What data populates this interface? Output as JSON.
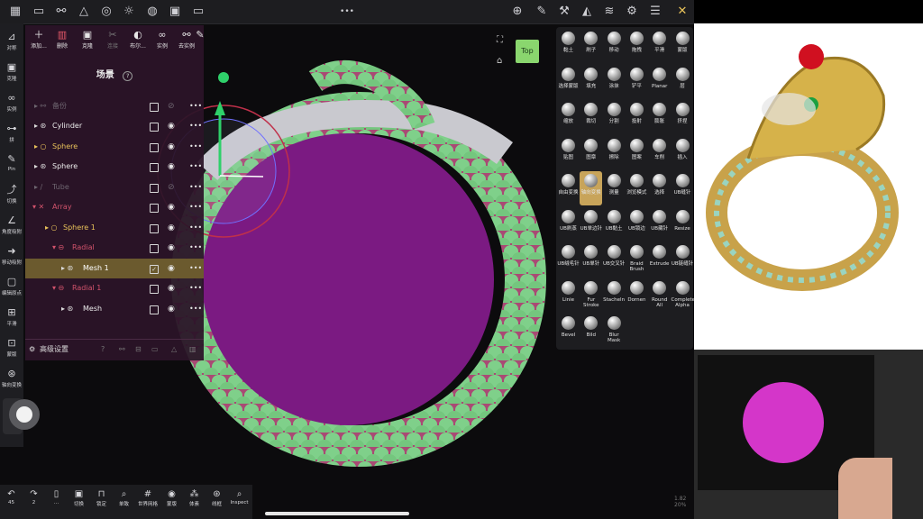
{
  "toolbar": {
    "icons": [
      "folder-icon",
      "share-graph-icon",
      "mesh-icon",
      "globe-icon",
      "sun-icon",
      "material-ball-icon",
      "image-icon",
      "video-icon"
    ],
    "dots": "•••"
  },
  "left_tools": [
    {
      "label": "对称",
      "icon": "symmetry-icon"
    },
    {
      "label": "克隆",
      "icon": "clone-icon"
    },
    {
      "label": "实例",
      "icon": "link-icon"
    },
    {
      "label": "拼",
      "icon": "join-icon"
    },
    {
      "label": "Pin",
      "icon": "pin-icon"
    },
    {
      "label": "切换",
      "icon": "switch-icon"
    },
    {
      "label": "角度吸附",
      "icon": "angle-snap-icon"
    },
    {
      "label": "移动吸附",
      "icon": "move-snap-icon"
    },
    {
      "label": "编辑原点",
      "icon": "lock-icon"
    },
    {
      "label": "平滑",
      "icon": "smooth-icon"
    },
    {
      "label": "蒙版",
      "icon": "mask-icon"
    },
    {
      "label": "轴向变换",
      "icon": "gizmo-icon"
    }
  ],
  "scene_panel": {
    "tools": [
      {
        "label": "添加...",
        "icon": "plus-icon"
      },
      {
        "label": "删除",
        "icon": "trash-icon"
      },
      {
        "label": "克隆",
        "icon": "clone-icon"
      },
      {
        "label": "连接",
        "icon": "connect-icon"
      },
      {
        "label": "布尔...",
        "icon": "boolean-icon"
      },
      {
        "label": "实例",
        "icon": "link-icon"
      },
      {
        "label": "去实例",
        "icon": "unlink-icon"
      },
      {
        "label": "",
        "icon": "pin-icon"
      }
    ],
    "title": "场景",
    "help": "?",
    "rows": [
      {
        "name": "备份",
        "color": "#6e6670"
      },
      {
        "name": "Cylinder",
        "color": "#ececec"
      },
      {
        "name": "Sphere",
        "color": "#e8c25a"
      },
      {
        "name": "Sphere",
        "color": "#ececec"
      },
      {
        "name": "Tube",
        "color": "#6e6670"
      },
      {
        "name": "Array",
        "color": "#d2536c"
      },
      {
        "name": "Sphere 1",
        "color": "#e8c25a"
      },
      {
        "name": "Radial",
        "color": "#d2536c"
      },
      {
        "name": "Mesh 1",
        "color": "#ffffff"
      },
      {
        "name": "Radial 1",
        "color": "#d2536c"
      },
      {
        "name": "Mesh",
        "color": "#ececec"
      }
    ],
    "footer_label": "高级设置"
  },
  "view_widget": {
    "label": "Top"
  },
  "brushes": [
    "黏土",
    "刷子",
    "移动",
    "拖拽",
    "平滑",
    "蒙版",
    "选择蒙版",
    "填充",
    "涂抹",
    "铲平",
    "Planar",
    "层",
    "缩放",
    "裁切",
    "分割",
    "投射",
    "膨胀",
    "挤捏",
    "贴图",
    "图章",
    "擦除",
    "图案",
    "车削",
    "插入",
    "自由变换",
    "轴向变换",
    "测量",
    "浏览模式",
    "选择",
    "UB缝针",
    "UB刷蒸",
    "UB单边针",
    "UB黏土",
    "UB锁边",
    "UB藏针",
    "Resize",
    "UB绒毛针",
    "UB单针",
    "UB交叉针",
    "Braid Brush",
    "Extrude",
    "UB链缝针",
    "Linie",
    "Fur Stroke",
    "Stacheln",
    "Dornen",
    "Round All",
    "Complete Alpha",
    "Bevel",
    "Bild",
    "Blur Mask"
  ],
  "bottom": [
    {
      "label": "45",
      "icon": "undo-icon"
    },
    {
      "label": "2",
      "icon": "redo-icon"
    },
    {
      "label": "...",
      "icon": "device-icon"
    },
    {
      "label": "切换",
      "icon": "image-switch-icon"
    },
    {
      "label": "锁定",
      "icon": "lock-icon"
    },
    {
      "label": "单致",
      "icon": "search-icon"
    },
    {
      "label": "世界网格",
      "icon": "grid-icon"
    },
    {
      "label": "蒙版",
      "icon": "eye-icon"
    },
    {
      "label": "体素",
      "icon": "voxel-icon"
    },
    {
      "label": "线框",
      "icon": "wireframe-icon"
    },
    {
      "label": "Inspect",
      "icon": "inspect-icon"
    }
  ],
  "stats": {
    "line1": "1.82",
    "line2": "20%"
  },
  "colors": {
    "selected_row": "#6b5a2e",
    "panel_bg": "#2c1428",
    "magenta": "#7b1a82",
    "scale_green": "#7fd08a",
    "ring_red": "#c0304a",
    "gizmo_green": "#2fd06a"
  }
}
